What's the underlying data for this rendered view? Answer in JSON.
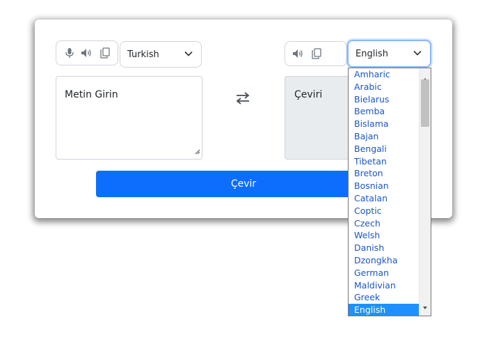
{
  "source": {
    "language": "Turkish",
    "placeholder": "Metin Girin",
    "icons": [
      "microphone-icon",
      "speaker-icon",
      "copy-icon"
    ]
  },
  "target": {
    "language": "English",
    "placeholder": "Çeviri",
    "icons": [
      "speaker-icon",
      "copy-icon"
    ]
  },
  "translate_button": "Çevir",
  "dropdown": {
    "options": [
      "Amharic",
      "Arabic",
      "Bielarus",
      "Bemba",
      "Bislama",
      "Bajan",
      "Bengali",
      "Tibetan",
      "Breton",
      "Bosnian",
      "Catalan",
      "Coptic",
      "Czech",
      "Welsh",
      "Danish",
      "Dzongkha",
      "German",
      "Maldivian",
      "Greek",
      "English"
    ],
    "selected": "English"
  },
  "colors": {
    "primary": "#0d6efd",
    "selected_option": "#1e90ff",
    "option_text": "#1a56c8"
  }
}
